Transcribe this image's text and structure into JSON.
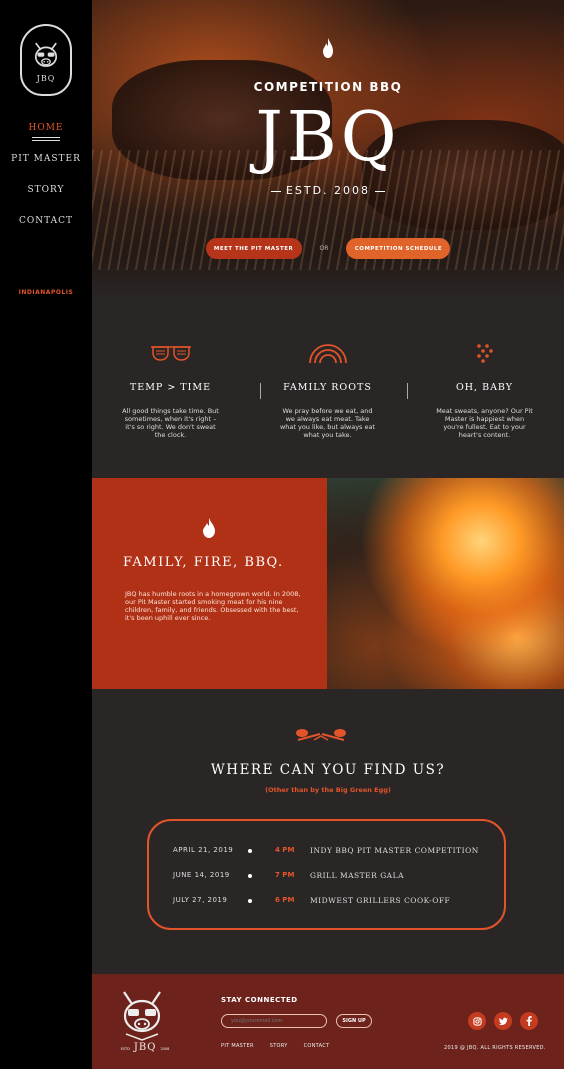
{
  "sidebar": {
    "logo_text": "JBQ",
    "nav": [
      {
        "label": "HOME",
        "active": true
      },
      {
        "label": "PIT MASTER",
        "active": false
      },
      {
        "label": "STORY",
        "active": false
      },
      {
        "label": "CONTACT",
        "active": false
      }
    ],
    "city": "INDIANAPOLIS"
  },
  "hero": {
    "subtitle": "COMPETITION BBQ",
    "title": "JBQ",
    "estd": "ESTD. 2008",
    "btn_pit": "MEET THE PIT MASTER",
    "or": "OR",
    "btn_schedule": "COMPETITION SCHEDULE"
  },
  "features": [
    {
      "icon": "sunglasses-icon",
      "title": "TEMP > TIME",
      "desc": "All good things take time. But sometimes, when it's right – it's so right. We don't sweat the clock."
    },
    {
      "icon": "rainbow-icon",
      "title": "FAMILY ROOTS",
      "desc": "We pray before we eat, and we always eat meat. Take what you like, but always eat what you take."
    },
    {
      "icon": "dots-icon",
      "title": "OH, BABY",
      "desc": "Meat sweats, anyone? Our Pit Master is happiest when you're fullest.  Eat to your heart's content."
    }
  ],
  "family": {
    "title": "FAMILY, FIRE, BBQ.",
    "text": "JBQ has humble roots in a homegrown world. In 2008, our Pit Master started smoking meat for his nine children, family, and friends. Obsessed with the best, it's been uphill ever since."
  },
  "find": {
    "title": "WHERE CAN YOU FIND US?",
    "subtitle": "(Other than by the Big Green Egg)",
    "events": [
      {
        "date": "APRIL 21, 2019",
        "time": "4 PM",
        "name": "INDY BBQ PIT MASTER COMPETITION"
      },
      {
        "date": "JUNE 14, 2019",
        "time": "7 PM",
        "name": "GRILL MASTER GALA"
      },
      {
        "date": "JULY  27, 2019",
        "time": "6 PM",
        "name": "MIDWEST GRILLERS COOK-OFF"
      }
    ]
  },
  "footer": {
    "logo_text": "JBQ",
    "logo_small_left": "ESTD",
    "logo_small_right": "2008",
    "stay": "STAY CONNECTED",
    "email_placeholder": "you@youremail.com",
    "signup": "SIGN UP",
    "links": [
      "PIT MASTER",
      "STORY",
      "CONTACT"
    ],
    "social": [
      "instagram-icon",
      "twitter-icon",
      "facebook-icon"
    ],
    "copyright": "2019 @ JBQ. ALL RIGHTS RESERVED."
  },
  "colors": {
    "accent": "#e2542a",
    "feature_bg": "#b13116",
    "footer_bg": "#6d231c",
    "main_bg": "#2a2626"
  }
}
